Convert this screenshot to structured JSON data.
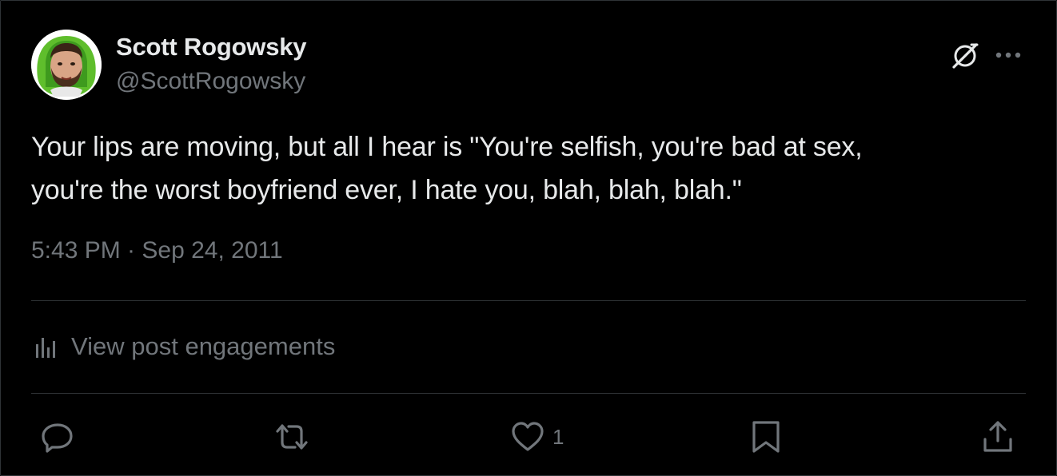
{
  "author": {
    "name": "Scott Rogowsky",
    "handle": "@ScottRogowsky"
  },
  "tweet": {
    "text": "Your lips are moving, but all I hear is \"You're selfish, you're bad at sex,\nyou're the worst boyfriend ever, I hate you, blah, blah, blah.\"",
    "timestamp": "5:43 PM · Sep 24, 2011"
  },
  "engagements": {
    "label": "View post engagements",
    "icon": "bar-chart-icon"
  },
  "actions": {
    "reply": {
      "icon": "reply-icon",
      "count": ""
    },
    "repost": {
      "icon": "repost-icon",
      "count": ""
    },
    "like": {
      "icon": "heart-icon",
      "count": "1"
    },
    "bookmark": {
      "icon": "bookmark-icon",
      "count": ""
    },
    "share": {
      "icon": "share-icon",
      "count": ""
    }
  },
  "header_icons": {
    "grok": "grok-icon",
    "more": "more-icon"
  },
  "colors": {
    "background": "#000000",
    "text_primary": "#e7e9ea",
    "text_secondary": "#71767b",
    "divider": "#2f3336",
    "avatar_accent": "#5fbe2c"
  }
}
